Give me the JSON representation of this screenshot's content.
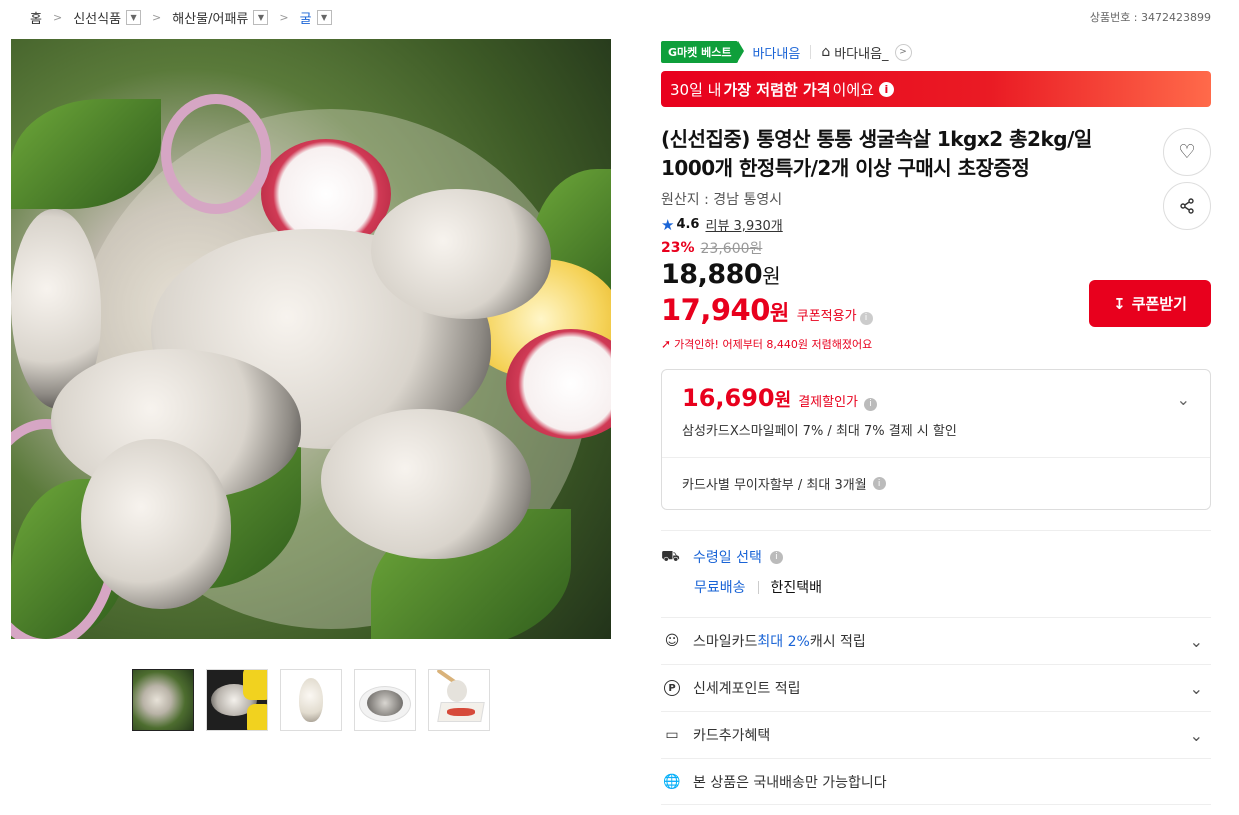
{
  "breadcrumb": {
    "items": [
      {
        "label": "홈",
        "has_dropdown": false
      },
      {
        "label": "신선식품",
        "has_dropdown": true
      },
      {
        "label": "해산물/어패류",
        "has_dropdown": true
      },
      {
        "label": "굴",
        "has_dropdown": true
      }
    ]
  },
  "product_number": "상품번호 : 3472423899",
  "badge": {
    "label": "G마켓 베스트"
  },
  "brand": "바다내음",
  "store": {
    "icon": "home-icon",
    "name": "바다내음_"
  },
  "lowest_price_banner": {
    "prefix": "30일 내 ",
    "emphasis": "가장 저렴한 가격",
    "suffix": "이에요",
    "info_icon": "info-icon"
  },
  "title": "(신선집중) 통영산 통통 생굴속살 1kgx2 총2kg/일 1000개 한정특가/2개 이상 구매시 초장증정",
  "actions": {
    "wish_icon": "heart-icon",
    "share_icon": "share-icon"
  },
  "origin": "원산지 : 경남 통영시",
  "rating": {
    "score": "4.6",
    "reviews": "리뷰 3,930개"
  },
  "discount": {
    "percent": "23%",
    "original": "23,600원"
  },
  "price": {
    "value": "18,880",
    "unit": "원"
  },
  "coupon_price": {
    "value": "17,940",
    "unit": "원",
    "label": "쿠폰적용가"
  },
  "price_drop": {
    "text": "가격인하! 어제부터 8,440원 저렴해졌어요"
  },
  "coupon_button": {
    "label": "쿠폰받기",
    "icon": "download-icon"
  },
  "payment": {
    "value": "16,690",
    "unit": "원",
    "label": "결제할인가",
    "desc": "삼성카드X스마일페이 7% / 최대 7% 결제 시 할인",
    "installment": "카드사별 무이자할부 / 최대 3개월"
  },
  "shipping": {
    "title": "수령일 선택",
    "fee": "무료배송",
    "carrier": "한진택배"
  },
  "benefits": [
    {
      "icon": "smile-icon",
      "before": "스마일카드 ",
      "highlight": "최대 2%",
      "after": " 캐시 적립",
      "expandable": true
    },
    {
      "icon": "point-icon",
      "before": "신세계포인트 적립",
      "highlight": "",
      "after": "",
      "expandable": true
    },
    {
      "icon": "card-icon",
      "before": "카드추가혜택",
      "highlight": "",
      "after": "",
      "expandable": true
    },
    {
      "icon": "globe-icon",
      "before": "본 상품은 국내배송만 가능합니다",
      "highlight": "",
      "after": "",
      "expandable": false
    }
  ],
  "colors": {
    "accent_red": "#e8001d",
    "link_blue": "#1a64d6",
    "badge_green": "#0f9f3b"
  }
}
